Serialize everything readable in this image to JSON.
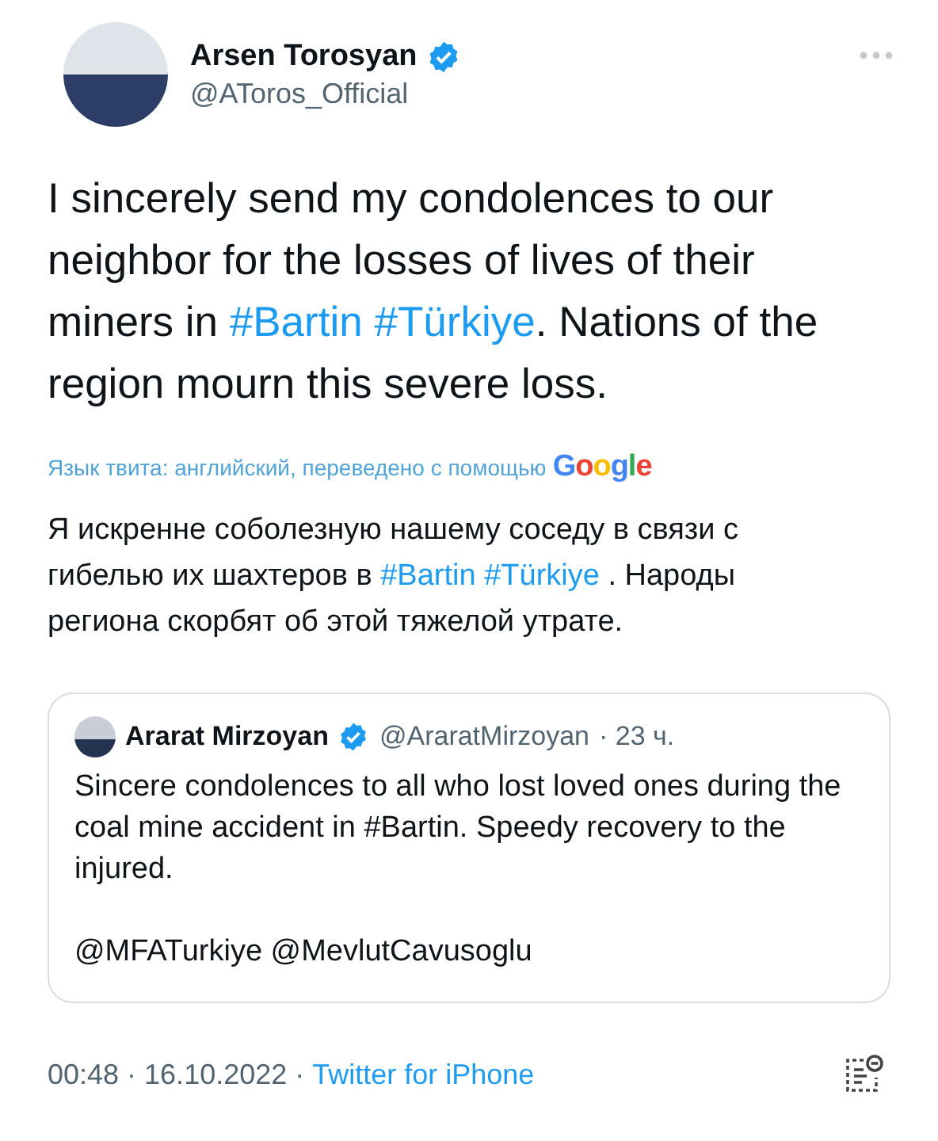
{
  "author": {
    "name": "Arsen Torosyan",
    "verified": true,
    "handle": "@AToros_Official"
  },
  "tweet_text": [
    {
      "kind": "plain",
      "text": "I sincerely send my condolences to our neighbor for the losses of lives of their miners in "
    },
    {
      "kind": "hashtag",
      "text": "#Bartin"
    },
    {
      "kind": "space"
    },
    {
      "kind": "hashtag",
      "text": "#Türkiye"
    },
    {
      "kind": "plain",
      "text": ". Nations of the region mourn this severe loss."
    }
  ],
  "translation": {
    "label": "Язык твита: английский, переведено с помощью",
    "provider": "Google"
  },
  "translated_text": [
    {
      "kind": "plain",
      "text": "Я искренне соболезную нашему соседу в связи с гибелью их шахтеров в "
    },
    {
      "kind": "hashtag",
      "text": "#Bartin"
    },
    {
      "kind": "space"
    },
    {
      "kind": "hashtag",
      "text": "#Türkiye"
    },
    {
      "kind": "plain",
      "text": " . Народы региона скорбят об этой тяжелой утрате."
    }
  ],
  "quoted_tweet": {
    "name": "Ararat Mirzoyan",
    "verified": true,
    "handle": "@AraratMirzoyan",
    "time": "· 23 ч.",
    "text": "Sincere condolences to all who lost loved ones during the coal mine accident in #Bartin. Speedy recovery to the injured.",
    "mentions": "@MFATurkiye @MevlutCavusoglu"
  },
  "footer": {
    "timestamp": "00:48 · 16.10.2022 ·",
    "source": "Twitter for iPhone"
  }
}
